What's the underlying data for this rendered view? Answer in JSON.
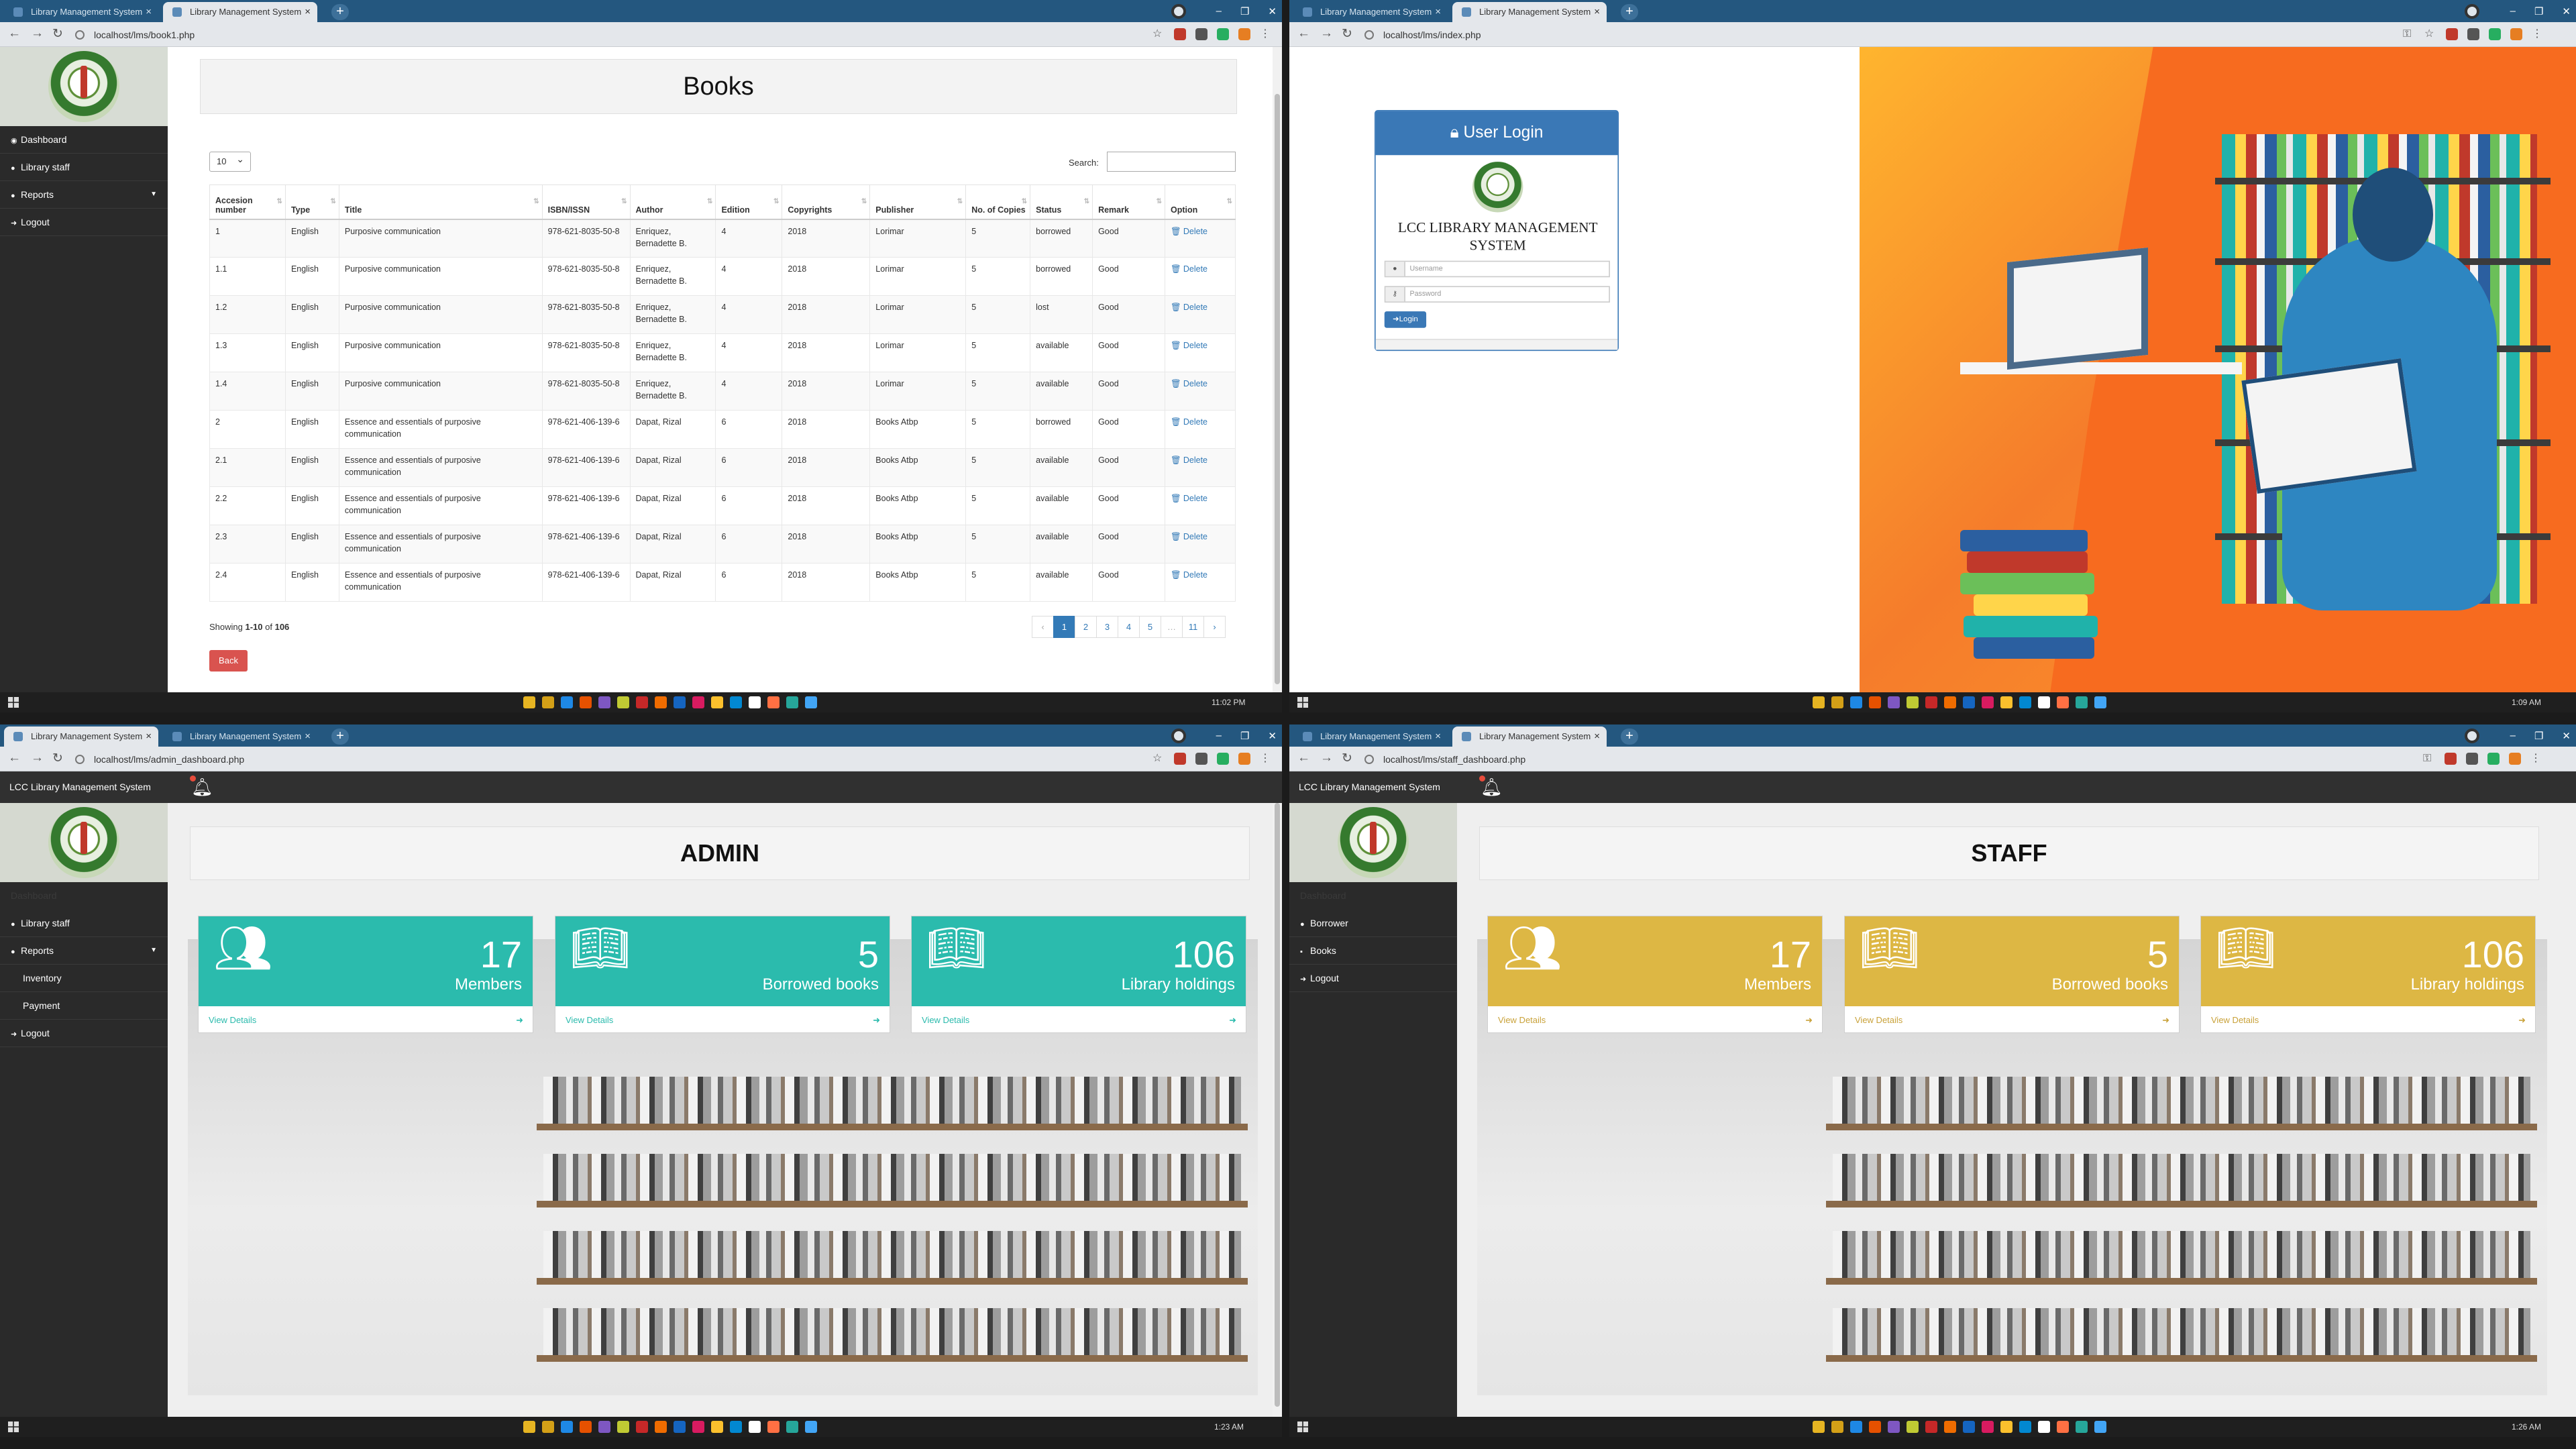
{
  "tl": {
    "tabs": [
      "Library Management System",
      "Library Management System"
    ],
    "url": "localhost/lms/book1.php",
    "menu": [
      "Dashboard",
      "Library staff",
      "Reports",
      "Logout"
    ],
    "title": "Books",
    "length_value": "10",
    "search_label": "Search:",
    "columns": [
      "Accesion number",
      "Type",
      "Title",
      "ISBN/ISSN",
      "Author",
      "Edition",
      "Copyrights",
      "Publisher",
      "No. of Copies",
      "Status",
      "Remark",
      "Option"
    ],
    "rows": [
      [
        "1",
        "English",
        "Purposive communication",
        "978-621-8035-50-8",
        "Enriquez, Bernadette B.",
        "4",
        "2018",
        "Lorimar",
        "5",
        "borrowed",
        "Good",
        "Delete"
      ],
      [
        "1.1",
        "English",
        "Purposive communication",
        "978-621-8035-50-8",
        "Enriquez, Bernadette B.",
        "4",
        "2018",
        "Lorimar",
        "5",
        "borrowed",
        "Good",
        "Delete"
      ],
      [
        "1.2",
        "English",
        "Purposive communication",
        "978-621-8035-50-8",
        "Enriquez, Bernadette B.",
        "4",
        "2018",
        "Lorimar",
        "5",
        "lost",
        "Good",
        "Delete"
      ],
      [
        "1.3",
        "English",
        "Purposive communication",
        "978-621-8035-50-8",
        "Enriquez, Bernadette B.",
        "4",
        "2018",
        "Lorimar",
        "5",
        "available",
        "Good",
        "Delete"
      ],
      [
        "1.4",
        "English",
        "Purposive communication",
        "978-621-8035-50-8",
        "Enriquez, Bernadette B.",
        "4",
        "2018",
        "Lorimar",
        "5",
        "available",
        "Good",
        "Delete"
      ],
      [
        "2",
        "English",
        "Essence and essentials of purposive communication",
        "978-621-406-139-6",
        "Dapat, Rizal",
        "6",
        "2018",
        "Books Atbp",
        "5",
        "borrowed",
        "Good",
        "Delete"
      ],
      [
        "2.1",
        "English",
        "Essence and essentials of purposive communication",
        "978-621-406-139-6",
        "Dapat, Rizal",
        "6",
        "2018",
        "Books Atbp",
        "5",
        "available",
        "Good",
        "Delete"
      ],
      [
        "2.2",
        "English",
        "Essence and essentials of purposive communication",
        "978-621-406-139-6",
        "Dapat, Rizal",
        "6",
        "2018",
        "Books Atbp",
        "5",
        "available",
        "Good",
        "Delete"
      ],
      [
        "2.3",
        "English",
        "Essence and essentials of purposive communication",
        "978-621-406-139-6",
        "Dapat, Rizal",
        "6",
        "2018",
        "Books Atbp",
        "5",
        "available",
        "Good",
        "Delete"
      ],
      [
        "2.4",
        "English",
        "Essence and essentials of purposive communication",
        "978-621-406-139-6",
        "Dapat, Rizal",
        "6",
        "2018",
        "Books Atbp",
        "5",
        "available",
        "Good",
        "Delete"
      ]
    ],
    "showing_pre": "Showing ",
    "showing_range": "1-10",
    "showing_mid": " of ",
    "showing_total": "106",
    "pages": [
      "‹",
      "1",
      "2",
      "3",
      "4",
      "5",
      "…",
      "11",
      "›"
    ],
    "back": "Back",
    "clock": "11:02 PM"
  },
  "tr": {
    "tabs": [
      "Library Management System",
      "Library Management System"
    ],
    "url": "localhost/lms/index.php",
    "card_title": "User Login",
    "app_name": "LCC LIBRARY MANAGEMENT SYSTEM",
    "username_ph": "Username",
    "password_ph": "Password",
    "login_btn": "Login",
    "clock": "1:09 AM"
  },
  "bl": {
    "tabs": [
      "Library Management System",
      "Library Management System"
    ],
    "url": "localhost/lms/admin_dashboard.php",
    "brand": "LCC Library Management System",
    "menu": [
      "Library staff",
      "Reports",
      "Inventory",
      "Payment",
      "Logout"
    ],
    "dash_label": "Dashboard",
    "title": "ADMIN",
    "cards": [
      {
        "num": "17",
        "label": "Members",
        "link": "View Details"
      },
      {
        "num": "5",
        "label": "Borrowed books",
        "link": "View Details"
      },
      {
        "num": "106",
        "label": "Library holdings",
        "link": "View Details"
      }
    ],
    "clock": "1:23 AM"
  },
  "br": {
    "tabs": [
      "Library Management System",
      "Library Management System"
    ],
    "url": "localhost/lms/staff_dashboard.php",
    "brand": "LCC Library Management System",
    "menu": [
      "Borrower",
      "Books",
      "Logout"
    ],
    "dash_label": "Dashboard",
    "title": "STAFF",
    "cards": [
      {
        "num": "17",
        "label": "Members",
        "link": "View Details"
      },
      {
        "num": "5",
        "label": "Borrowed books",
        "link": "View Details"
      },
      {
        "num": "106",
        "label": "Library holdings",
        "link": "View Details"
      }
    ],
    "clock": "1:26 AM"
  },
  "colors": {
    "accent_blue": "#24577f",
    "teal": "#2bbbad",
    "gold": "#ddb744",
    "danger": "#d9534f"
  }
}
